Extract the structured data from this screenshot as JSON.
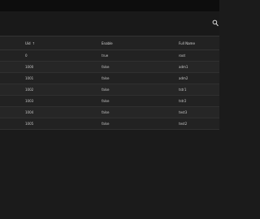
{
  "table": {
    "columns": {
      "uid": "Uid",
      "uid_sort": "↑",
      "enabled": "Enable",
      "full_name": "Full Name"
    },
    "rows": [
      {
        "uid": "0",
        "enabled": "true",
        "full_name": "root"
      },
      {
        "uid": "1000",
        "enabled": "false",
        "full_name": "adm1"
      },
      {
        "uid": "1001",
        "enabled": "false",
        "full_name": "adm2"
      },
      {
        "uid": "1002",
        "enabled": "false",
        "full_name": "tstr1"
      },
      {
        "uid": "1003",
        "enabled": "false",
        "full_name": "tstr2"
      },
      {
        "uid": "1004",
        "enabled": "false",
        "full_name": "test3"
      },
      {
        "uid": "1005",
        "enabled": "false",
        "full_name": "test2"
      }
    ]
  },
  "icons": {
    "search": "search-icon"
  }
}
